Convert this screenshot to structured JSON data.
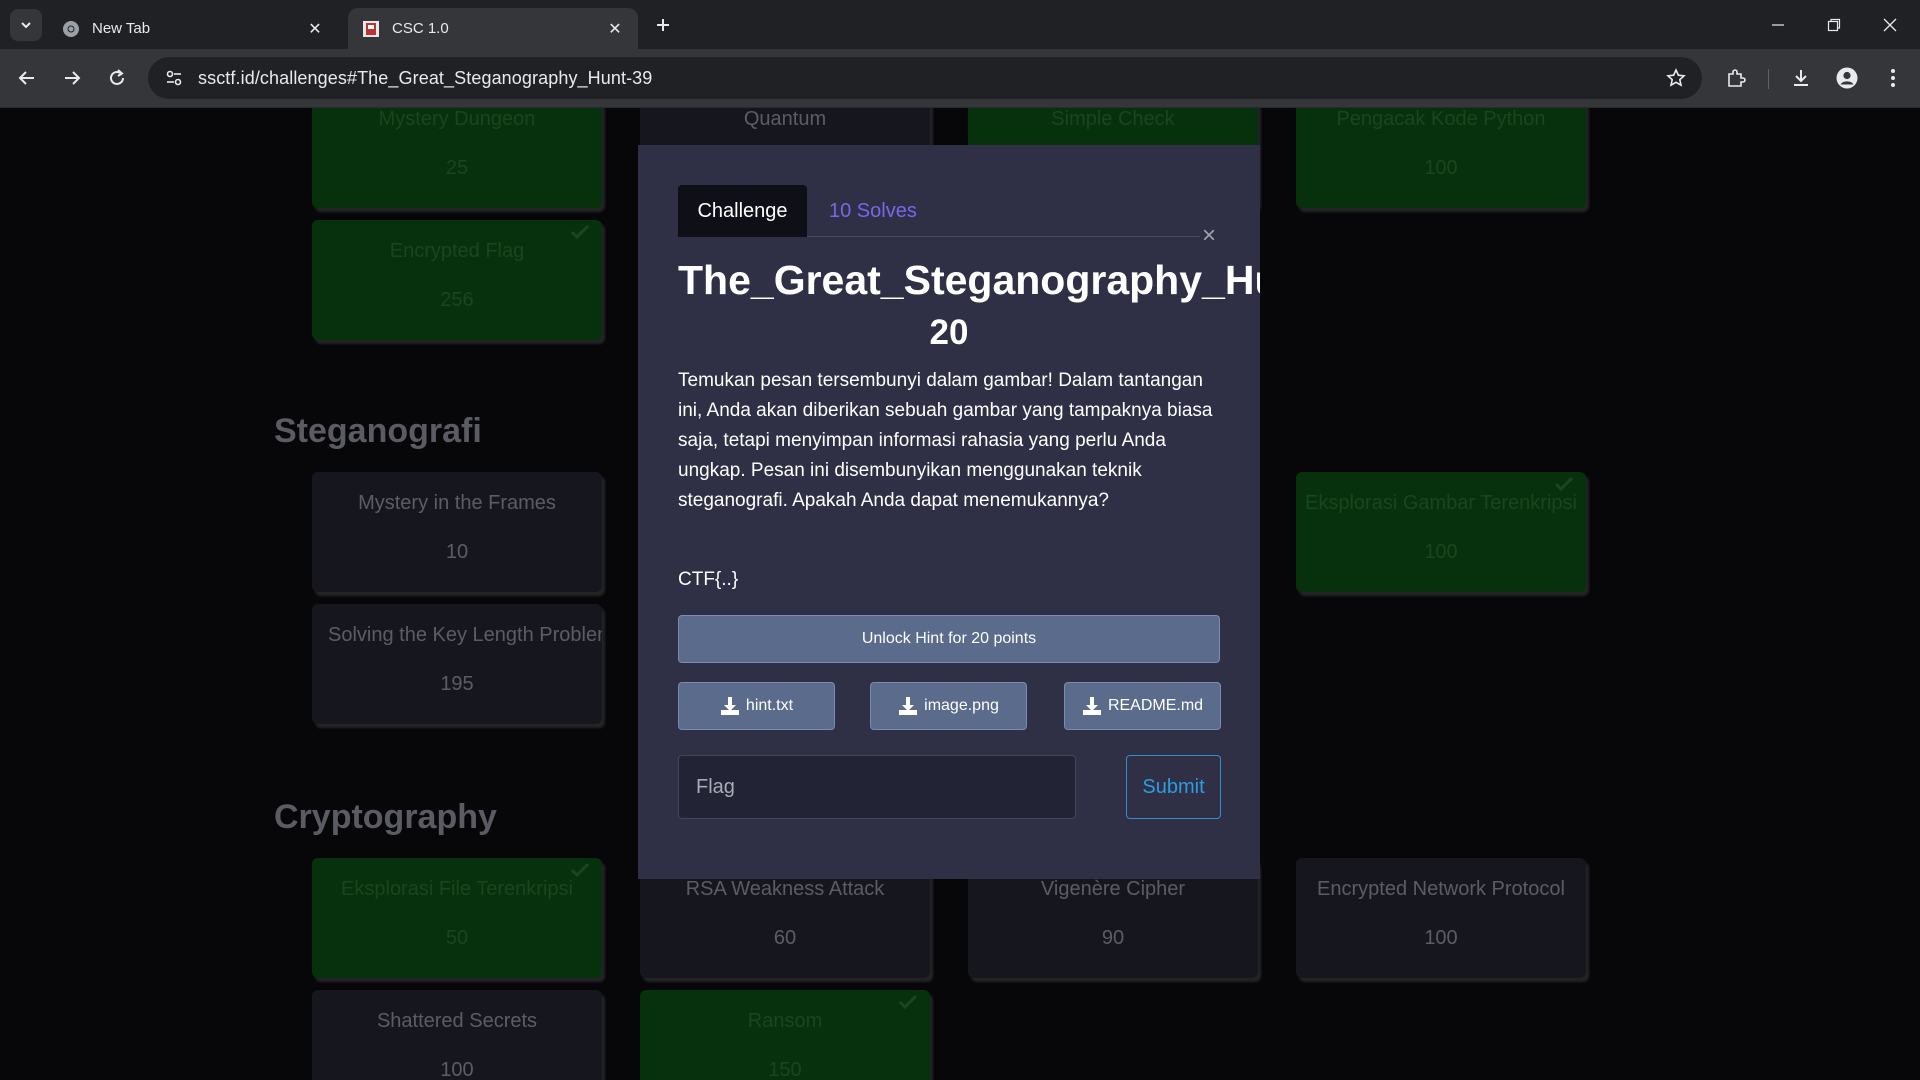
{
  "browser": {
    "tabs": [
      {
        "title": "New Tab",
        "icon": "chrome-icon",
        "active": false
      },
      {
        "title": "CSC 1.0",
        "icon": "site-favicon",
        "active": true
      }
    ],
    "url": "ssctf.id/challenges#The_Great_Steganography_Hunt-39"
  },
  "sections": [
    {
      "title": "Steganografi"
    },
    {
      "title": "Cryptography"
    }
  ],
  "cards": [
    {
      "name": "Mystery Dungeon",
      "points": "25",
      "solved": true
    },
    {
      "name": "Quantum",
      "points": "",
      "solved": false
    },
    {
      "name": "Simple Check",
      "points": "",
      "solved": true
    },
    {
      "name": "Pengacak Kode Python",
      "points": "100",
      "solved": true
    },
    {
      "name": "Encrypted Flag",
      "points": "256",
      "solved": true
    },
    {
      "name": "Mystery in the Frames",
      "points": "10",
      "solved": false
    },
    {
      "name": "Eksplorasi Gambar Terenkripsi",
      "points": "100",
      "solved": true
    },
    {
      "name": "Solving the Key Length Problem",
      "points": "195",
      "solved": false
    },
    {
      "name": "Eksplorasi File Terenkripsi",
      "points": "50",
      "solved": true
    },
    {
      "name": "RSA Weakness Attack",
      "points": "60",
      "solved": false
    },
    {
      "name": "Vigenère Cipher",
      "points": "90",
      "solved": false
    },
    {
      "name": "Encrypted Network Protocol",
      "points": "100",
      "solved": false
    },
    {
      "name": "Shattered Secrets",
      "points": "100",
      "solved": false
    },
    {
      "name": "Ransom",
      "points": "150",
      "solved": true
    }
  ],
  "modal": {
    "tab_challenge": "Challenge",
    "tab_solves": "10 Solves",
    "close": "×",
    "title": "The_Great_Steganography_Hunt",
    "points": "20",
    "description": "Temukan pesan tersembunyi dalam gambar! Dalam tantangan ini, Anda akan diberikan sebuah gambar yang tampaknya biasa saja, tetapi menyimpan informasi rahasia yang perlu Anda ungkap. Pesan ini disembunyikan menggunakan teknik steganografi. Apakah Anda dapat menemukannya?",
    "flag_format": "CTF{..}",
    "hint_button": "Unlock Hint for 20 points",
    "files": [
      "hint.txt",
      "image.png",
      "README.md"
    ],
    "flag_placeholder": "Flag",
    "submit": "Submit"
  },
  "colors": {
    "solved_card": "#0c4a13",
    "unsolved_card": "#232330",
    "modal_bg": "#2f3045",
    "solves_link": "#7b65e8",
    "submit_accent": "#2f9be0",
    "file_button": "#5a6b8c"
  }
}
